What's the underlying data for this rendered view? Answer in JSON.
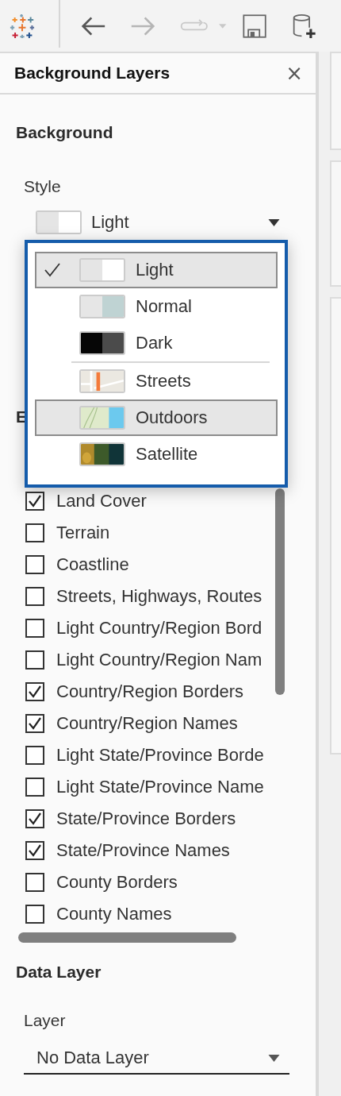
{
  "panel": {
    "title": "Background Layers",
    "close": "×"
  },
  "background": {
    "heading": "Background",
    "style_label": "Style",
    "style": {
      "value": "Light",
      "kind": "light"
    }
  },
  "style_menu": [
    {
      "label": "Light",
      "kind": "light",
      "selected": true,
      "highlighted": true,
      "divider_after": false
    },
    {
      "label": "Normal",
      "kind": "normal",
      "selected": false,
      "highlighted": false,
      "divider_after": false
    },
    {
      "label": "Dark",
      "kind": "dark",
      "selected": false,
      "highlighted": false,
      "divider_after": true
    },
    {
      "label": "Streets",
      "kind": "streets",
      "selected": false,
      "highlighted": false,
      "divider_after": false
    },
    {
      "label": "Outdoors",
      "kind": "outdoors",
      "selected": false,
      "highlighted": true,
      "divider_after": false
    },
    {
      "label": "Satellite",
      "kind": "satellite",
      "selected": false,
      "highlighted": false,
      "divider_after": false
    }
  ],
  "covered_heading": "E",
  "layers": [
    {
      "label": "Land Cover",
      "checked": true
    },
    {
      "label": "Terrain",
      "checked": false
    },
    {
      "label": "Coastline",
      "checked": false
    },
    {
      "label": "Streets, Highways, Routes",
      "checked": false
    },
    {
      "label": "Light Country/Region Bord",
      "checked": false
    },
    {
      "label": "Light Country/Region Nam",
      "checked": false
    },
    {
      "label": "Country/Region Borders",
      "checked": true
    },
    {
      "label": "Country/Region Names",
      "checked": true
    },
    {
      "label": "Light State/Province Borde",
      "checked": false
    },
    {
      "label": "Light State/Province Name",
      "checked": false
    },
    {
      "label": "State/Province Borders",
      "checked": true
    },
    {
      "label": "State/Province Names",
      "checked": true
    },
    {
      "label": "County Borders",
      "checked": false
    },
    {
      "label": "County Names",
      "checked": false
    }
  ],
  "data_layer": {
    "heading": "Data Layer",
    "layer_label": "Layer",
    "layer": "No Data Layer"
  }
}
